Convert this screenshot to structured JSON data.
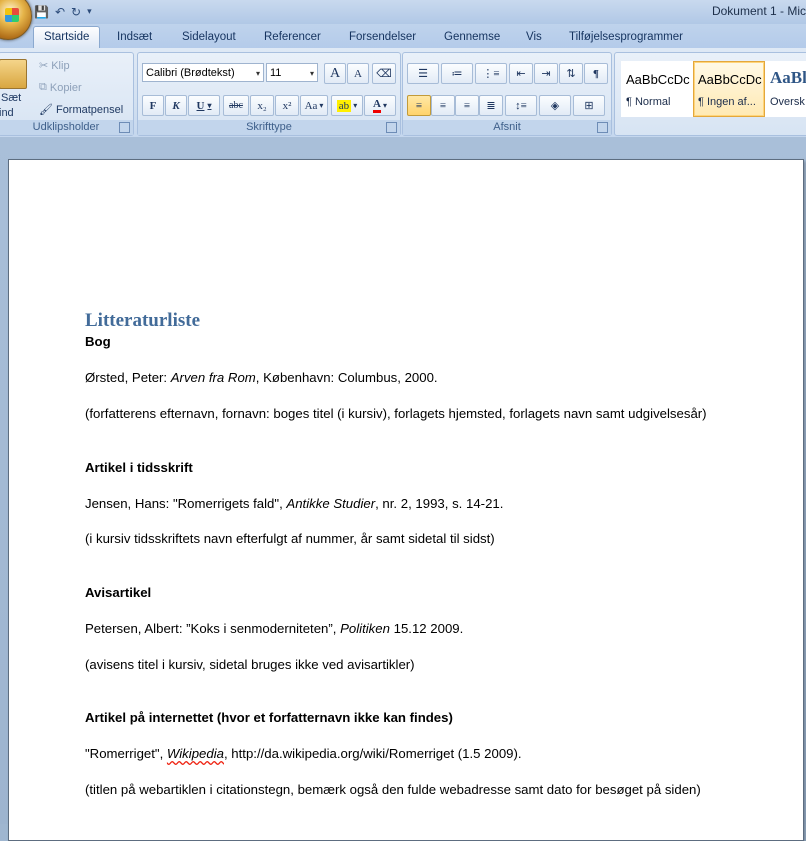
{
  "titlebar": {
    "title": "Dokument 1 - Mic"
  },
  "tabs": [
    "Startside",
    "Indsæt",
    "Sidelayout",
    "Referencer",
    "Forsendelser",
    "Gennemse",
    "Vis",
    "Tilføjelsesprogrammer"
  ],
  "clipboard": {
    "paste": "Sæt",
    "paste2": "ind",
    "cut": "Klip",
    "copy": "Kopier",
    "format_painter": "Formatpensel",
    "label": "Udklipsholder"
  },
  "font": {
    "family": "Calibri (Brødtekst)",
    "size": "11",
    "label": "Skrifttype",
    "bold": "F",
    "italic": "K",
    "underline": "U",
    "strike": "abc",
    "subscript": "x₂",
    "superscript": "x²",
    "case": "Aa",
    "grow": "A",
    "shrink": "A"
  },
  "paragraph": {
    "label": "Afsnit",
    "pilcrow": "¶"
  },
  "styles": [
    {
      "sample": "AaBbCcDc",
      "name": "¶ Normal"
    },
    {
      "sample": "AaBbCcDc",
      "name": "¶ Ingen af..."
    },
    {
      "sample": "AaBl",
      "name": "Oversk"
    }
  ],
  "document": {
    "heading": "Litteraturliste",
    "sections": [
      {
        "title": "Bog",
        "example_pre": "Ørsted, Peter: ",
        "example_italic": "Arven fra Rom",
        "example_post": ", København: Columbus, 2000.",
        "note": "(forfatterens efternavn, fornavn: boges titel (i kursiv), forlagets hjemsted, forlagets navn samt udgivelsesår)"
      },
      {
        "title": "Artikel i tidsskrift",
        "example_pre": "Jensen, Hans: \"Romerrigets fald\", ",
        "example_italic": "Antikke Studier",
        "example_post": ", nr. 2, 1993,  s. 14-21.",
        "note": "(i kursiv tidsskriftets navn efterfulgt af nummer, år samt sidetal til sidst)"
      },
      {
        "title": "Avisartikel",
        "example_pre": "Petersen, Albert: ”Koks i senmoderniteten”, ",
        "example_italic": "Politiken",
        "example_post": " 15.12 2009.",
        "note": "(avisens titel i kursiv, sidetal bruges ikke ved avisartikler)"
      },
      {
        "title": "Artikel på internettet (hvor et forfatternavn ikke kan findes)",
        "example_pre": "\"Romerriget\", ",
        "example_italic": "Wikipedia",
        "example_post": ", http://da.wikipedia.org/wiki/Romerriget (1.5 2009).",
        "note": "(titlen på webartiklen i citationstegn, bemærk også den fulde webadresse samt dato for besøget på siden)"
      }
    ]
  }
}
